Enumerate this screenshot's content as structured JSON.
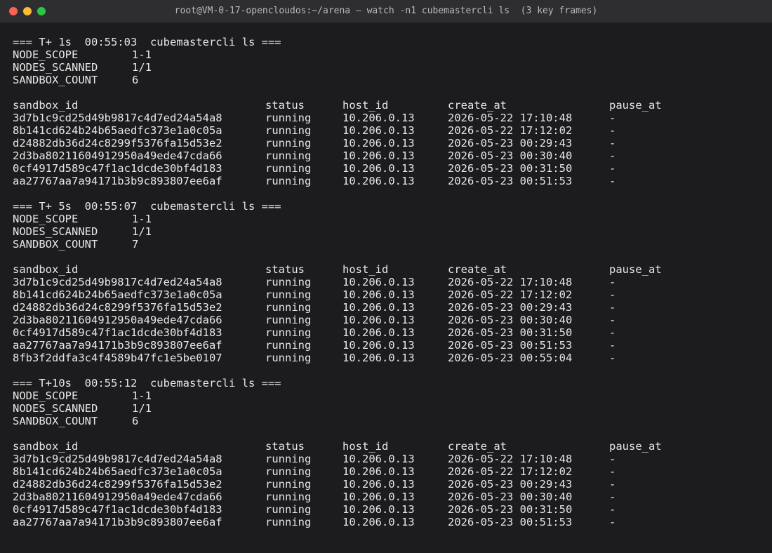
{
  "window": {
    "title": "root@VM-0-17-opencloudos:~/arena — watch -n1 cubemastercli ls  (3 key frames)"
  },
  "frames": [
    {
      "header": "=== T+ 1s  00:55:03  cubemastercli ls ===",
      "summary": [
        {
          "key": "NODE_SCOPE",
          "value": "1-1"
        },
        {
          "key": "NODES_SCANNED",
          "value": "1/1"
        },
        {
          "key": "SANDBOX_COUNT",
          "value": "6"
        }
      ],
      "columns": [
        "sandbox_id",
        "status",
        "host_id",
        "create_at",
        "pause_at"
      ],
      "rows": [
        [
          "3d7b1c9cd25d49b9817c4d7ed24a54a8",
          "running",
          "10.206.0.13",
          "2026-05-22 17:10:48",
          "-"
        ],
        [
          "8b141cd624b24b65aedfc373e1a0c05a",
          "running",
          "10.206.0.13",
          "2026-05-22 17:12:02",
          "-"
        ],
        [
          "d24882db36d24c8299f5376fa15d53e2",
          "running",
          "10.206.0.13",
          "2026-05-23 00:29:43",
          "-"
        ],
        [
          "2d3ba80211604912950a49ede47cda66",
          "running",
          "10.206.0.13",
          "2026-05-23 00:30:40",
          "-"
        ],
        [
          "0cf4917d589c47f1ac1dcde30bf4d183",
          "running",
          "10.206.0.13",
          "2026-05-23 00:31:50",
          "-"
        ],
        [
          "aa27767aa7a94171b3b9c893807ee6af",
          "running",
          "10.206.0.13",
          "2026-05-23 00:51:53",
          "-"
        ]
      ]
    },
    {
      "header": "=== T+ 5s  00:55:07  cubemastercli ls ===",
      "summary": [
        {
          "key": "NODE_SCOPE",
          "value": "1-1"
        },
        {
          "key": "NODES_SCANNED",
          "value": "1/1"
        },
        {
          "key": "SANDBOX_COUNT",
          "value": "7"
        }
      ],
      "columns": [
        "sandbox_id",
        "status",
        "host_id",
        "create_at",
        "pause_at"
      ],
      "rows": [
        [
          "3d7b1c9cd25d49b9817c4d7ed24a54a8",
          "running",
          "10.206.0.13",
          "2026-05-22 17:10:48",
          "-"
        ],
        [
          "8b141cd624b24b65aedfc373e1a0c05a",
          "running",
          "10.206.0.13",
          "2026-05-22 17:12:02",
          "-"
        ],
        [
          "d24882db36d24c8299f5376fa15d53e2",
          "running",
          "10.206.0.13",
          "2026-05-23 00:29:43",
          "-"
        ],
        [
          "2d3ba80211604912950a49ede47cda66",
          "running",
          "10.206.0.13",
          "2026-05-23 00:30:40",
          "-"
        ],
        [
          "0cf4917d589c47f1ac1dcde30bf4d183",
          "running",
          "10.206.0.13",
          "2026-05-23 00:31:50",
          "-"
        ],
        [
          "aa27767aa7a94171b3b9c893807ee6af",
          "running",
          "10.206.0.13",
          "2026-05-23 00:51:53",
          "-"
        ],
        [
          "8fb3f2ddfa3c4f4589b47fc1e5be0107",
          "running",
          "10.206.0.13",
          "2026-05-23 00:55:04",
          "-"
        ]
      ]
    },
    {
      "header": "=== T+10s  00:55:12  cubemastercli ls ===",
      "summary": [
        {
          "key": "NODE_SCOPE",
          "value": "1-1"
        },
        {
          "key": "NODES_SCANNED",
          "value": "1/1"
        },
        {
          "key": "SANDBOX_COUNT",
          "value": "6"
        }
      ],
      "columns": [
        "sandbox_id",
        "status",
        "host_id",
        "create_at",
        "pause_at"
      ],
      "rows": [
        [
          "3d7b1c9cd25d49b9817c4d7ed24a54a8",
          "running",
          "10.206.0.13",
          "2026-05-22 17:10:48",
          "-"
        ],
        [
          "8b141cd624b24b65aedfc373e1a0c05a",
          "running",
          "10.206.0.13",
          "2026-05-22 17:12:02",
          "-"
        ],
        [
          "d24882db36d24c8299f5376fa15d53e2",
          "running",
          "10.206.0.13",
          "2026-05-23 00:29:43",
          "-"
        ],
        [
          "2d3ba80211604912950a49ede47cda66",
          "running",
          "10.206.0.13",
          "2026-05-23 00:30:40",
          "-"
        ],
        [
          "0cf4917d589c47f1ac1dcde30bf4d183",
          "running",
          "10.206.0.13",
          "2026-05-23 00:31:50",
          "-"
        ],
        [
          "aa27767aa7a94171b3b9c893807ee6af",
          "running",
          "10.206.0.13",
          "2026-05-23 00:51:53",
          "-"
        ]
      ]
    }
  ]
}
